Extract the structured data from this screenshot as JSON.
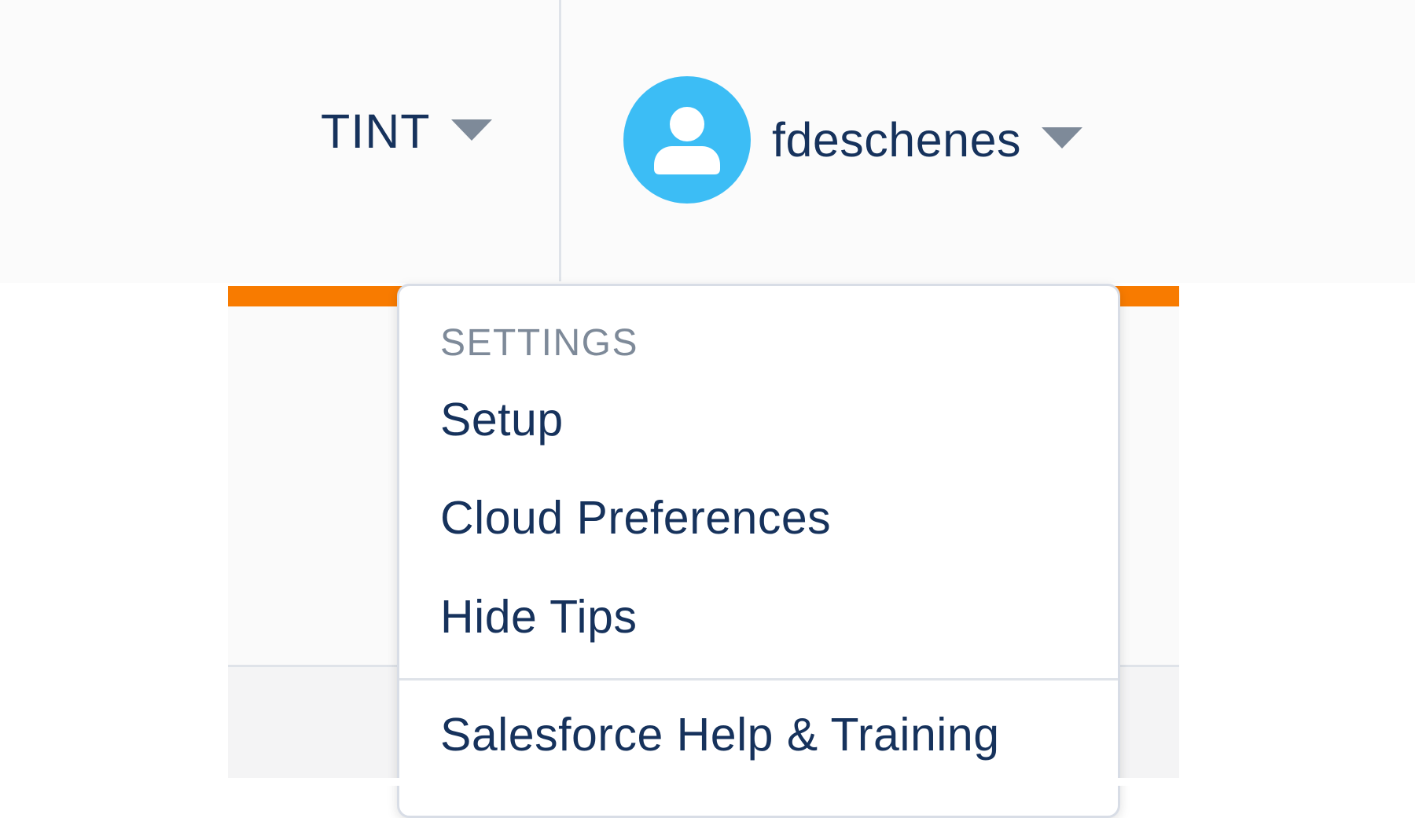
{
  "header": {
    "org_name": "TINT",
    "org_caret_icon": "caret-down-icon",
    "user_name": "fdeschenes",
    "avatar_icon": "user-avatar-icon",
    "user_caret_icon": "caret-down-icon"
  },
  "colors": {
    "accent_orange": "#f87b00",
    "avatar_blue": "#3cbdf5",
    "text_navy": "#16325c",
    "muted_gray": "#7e8a99"
  },
  "user_dropdown": {
    "section_header": "SETTINGS",
    "items": [
      {
        "label": "Setup"
      },
      {
        "label": "Cloud Preferences"
      },
      {
        "label": "Hide Tips"
      }
    ],
    "help_item": {
      "label": "Salesforce Help & Training"
    }
  }
}
